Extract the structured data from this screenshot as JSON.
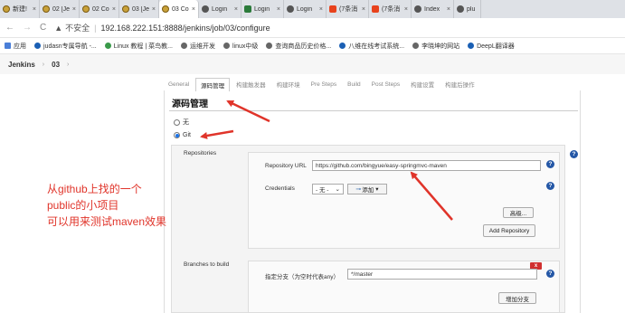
{
  "browser": {
    "tabs": [
      {
        "label": "新建!",
        "icon": "jenkins-icon"
      },
      {
        "label": "02 [Je",
        "icon": "jenkins-icon"
      },
      {
        "label": "02 Co",
        "icon": "jenkins-icon"
      },
      {
        "label": "03 [Je",
        "icon": "jenkins-icon"
      },
      {
        "label": "03 Co",
        "icon": "jenkins-icon",
        "active": true
      },
      {
        "label": "Login",
        "icon": "globe-icon"
      },
      {
        "label": "Login",
        "icon": "image-icon"
      },
      {
        "label": "Login",
        "icon": "globe-icon"
      },
      {
        "label": "(7条消",
        "icon": "csdn-icon"
      },
      {
        "label": "(7条消",
        "icon": "csdn-icon"
      },
      {
        "label": "Index",
        "icon": "globe-icon"
      },
      {
        "label": "plu",
        "icon": "globe-icon"
      }
    ],
    "tab_close": "×",
    "nav": {
      "back": "←",
      "forward": "→",
      "reload": "C"
    },
    "address": {
      "insecure_label": "不安全",
      "separator": "|",
      "url": "192.168.222.151:8888/jenkins/job/03/configure"
    },
    "bookmarks": [
      {
        "label": "应用",
        "icon": "apps-grid-icon"
      },
      {
        "label": "judasn专属导航 -...",
        "icon": "bookmark-icon"
      },
      {
        "label": "Linux 教程 | 菜鸟教...",
        "icon": "bookmark-icon"
      },
      {
        "label": "运维开发",
        "icon": "bookmark-icon"
      },
      {
        "label": "linux中级",
        "icon": "bookmark-icon"
      },
      {
        "label": "查询商品历史价格...",
        "icon": "bookmark-icon"
      },
      {
        "label": "八维在线考试系统...",
        "icon": "bookmark-icon"
      },
      {
        "label": "李晓坤的网站",
        "icon": "bookmark-icon"
      },
      {
        "label": "DeepL翻译器",
        "icon": "bookmark-icon"
      }
    ]
  },
  "jenkins": {
    "breadcrumb": [
      "Jenkins",
      "03"
    ],
    "breadcrumb_separator": "›",
    "config_tabs": [
      "General",
      "源码管理",
      "构建触发器",
      "构建环境",
      "Pre Steps",
      "Build",
      "Post Steps",
      "构建设置",
      "构建后操作"
    ],
    "active_tab_index": 1,
    "section_title": "源码管理",
    "scm_options": [
      {
        "label": "无",
        "checked": false
      },
      {
        "label": "Git",
        "checked": true
      }
    ],
    "repositories": {
      "label": "Repositories",
      "url_label": "Repository URL",
      "url_value": "https://github.com/bingyue/easy-springmvc-maven",
      "credentials_label": "Credentials",
      "credentials_select": "- 无 -",
      "add_button": "添加",
      "advanced_button": "高级...",
      "add_repository_button": "Add Repository"
    },
    "branches": {
      "label": "Branches to build",
      "specifier_label": "指定分支（为空时代表any）",
      "specifier_value": "*/master",
      "delete_button": "x",
      "add_branch_button": "增加分支"
    },
    "help": "?"
  },
  "annotation": {
    "lines": [
      "从github上找的一个",
      "public的小项目",
      "可以用来测试maven效果"
    ],
    "color": "#e0342a"
  }
}
